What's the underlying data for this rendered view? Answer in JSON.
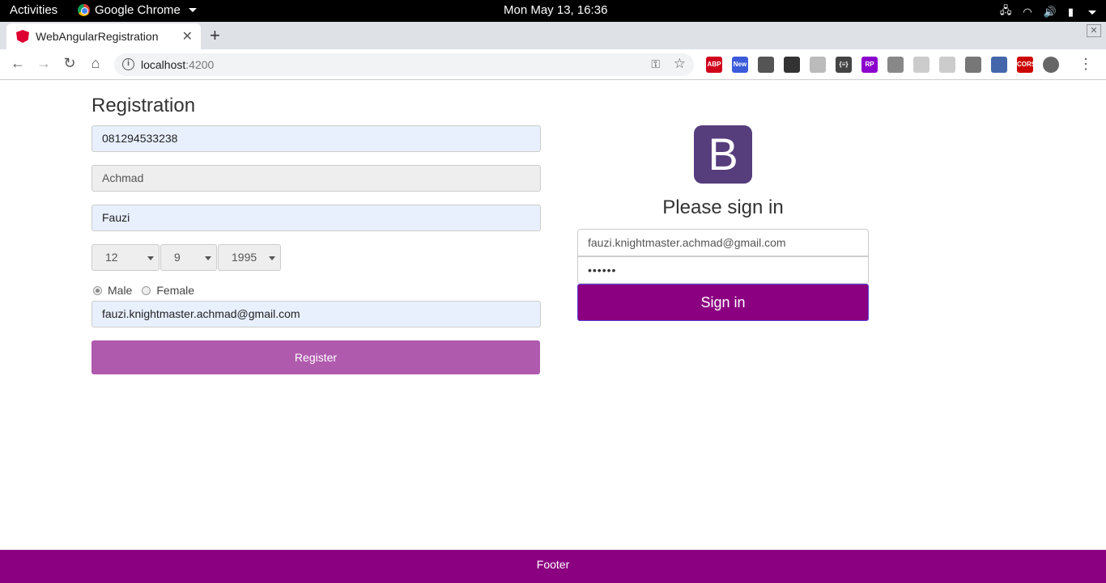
{
  "system_bar": {
    "activities": "Activities",
    "app_name": "Google Chrome",
    "clock": "Mon May 13, 16:36"
  },
  "browser": {
    "tab_title": "WebAngularRegistration",
    "tab_close": "✕",
    "new_tab": "+",
    "url_host": "localhost",
    "url_port": ":4200",
    "extensions": [
      {
        "name": "abp-icon",
        "label": "ABP",
        "color": "#d0021b"
      },
      {
        "name": "new-extension-icon",
        "label": "New",
        "color": "#3b5bdb"
      },
      {
        "name": "bulb-extension-icon",
        "label": "",
        "color": "#555555"
      },
      {
        "name": "sync-extension-icon",
        "label": "",
        "color": "#333333"
      },
      {
        "name": "grid-extension-icon",
        "label": "",
        "color": "#bbbbbb"
      },
      {
        "name": "json-extension-icon",
        "label": "{≡}",
        "color": "#444444"
      },
      {
        "name": "rp-extension-icon",
        "label": "RP",
        "color": "#8b00cc"
      },
      {
        "name": "puzzle-extension-icon",
        "label": "",
        "color": "#888888"
      },
      {
        "name": "u-extension-icon",
        "label": "",
        "color": "#cccccc"
      },
      {
        "name": "chat-extension-icon",
        "label": "",
        "color": "#cccccc"
      },
      {
        "name": "brush-extension-icon",
        "label": "",
        "color": "#777777"
      },
      {
        "name": "sheet-extension-icon",
        "label": "",
        "color": "#4466aa"
      },
      {
        "name": "cors-extension-icon",
        "label": "CORS",
        "color": "#cc0000"
      },
      {
        "name": "avatar-icon",
        "label": "",
        "color": "#666666"
      }
    ]
  },
  "registration": {
    "title": "Registration",
    "phone": "081294533238",
    "first_name": "Achmad",
    "last_name": "Fauzi",
    "dob_day": "12",
    "dob_month": "9",
    "dob_year": "1995",
    "gender_male": "Male",
    "gender_female": "Female",
    "email": "fauzi.knightmaster.achmad@gmail.com",
    "register_label": "Register"
  },
  "signin": {
    "logo_letter": "B",
    "title": "Please sign in",
    "email": "fauzi.knightmaster.achmad@gmail.com",
    "password_mask": "••••••",
    "button_label": "Sign in"
  },
  "footer": {
    "text": "Footer"
  },
  "colors": {
    "brand_purple": "#8b0080",
    "register_button": "#b05aad",
    "bootstrap_logo": "#563d7c"
  }
}
